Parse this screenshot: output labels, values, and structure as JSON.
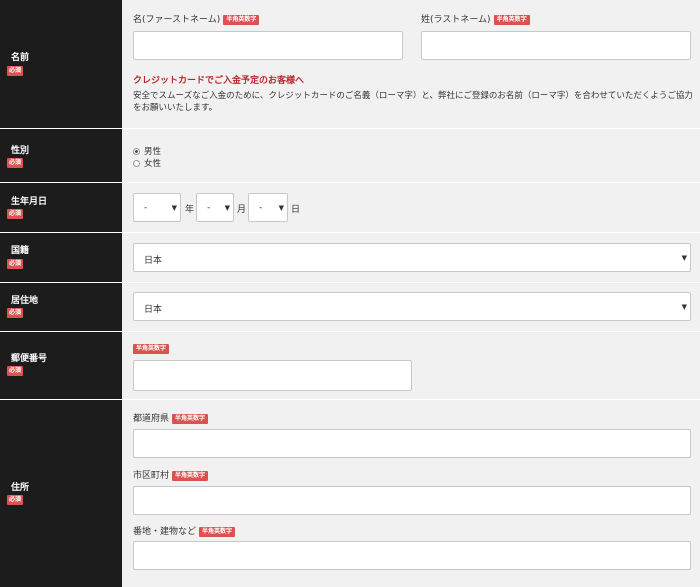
{
  "required_label": "必須",
  "badge_label": "半角英数字",
  "name": {
    "label": "名前",
    "first_label": "名(ファーストネーム)",
    "last_label": "姓(ラストネーム)",
    "first_value": "",
    "last_value": "",
    "notice_title": "クレジットカードでご入金予定のお客様へ",
    "notice_body": "安全でスムーズなご入金のために、クレジットカードのご名義（ローマ字）と、弊社にご登録のお名前（ローマ字）を合わせていただくようご協力をお願いいたします。"
  },
  "gender": {
    "label": "性別",
    "options": [
      "男性",
      "女性"
    ]
  },
  "birthdate": {
    "label": "生年月日",
    "year_value": "-",
    "month_value": "-",
    "day_value": "-",
    "year_unit": "年",
    "month_unit": "月",
    "day_unit": "日"
  },
  "nationality": {
    "label": "国籍",
    "value": "日本"
  },
  "residence": {
    "label": "居住地",
    "value": "日本"
  },
  "postal": {
    "label": "郵便番号",
    "value": ""
  },
  "address": {
    "label": "住所",
    "prefecture_label": "都道府県",
    "city_label": "市区町村",
    "street_label": "番地・建物など",
    "prefecture_value": "",
    "city_value": "",
    "street_value": ""
  },
  "colors": {
    "label_bg": "#1c1c1c",
    "badge_red": "#d9534f",
    "notice_red": "#c0272d",
    "row_bg": "#f1f1f1"
  }
}
